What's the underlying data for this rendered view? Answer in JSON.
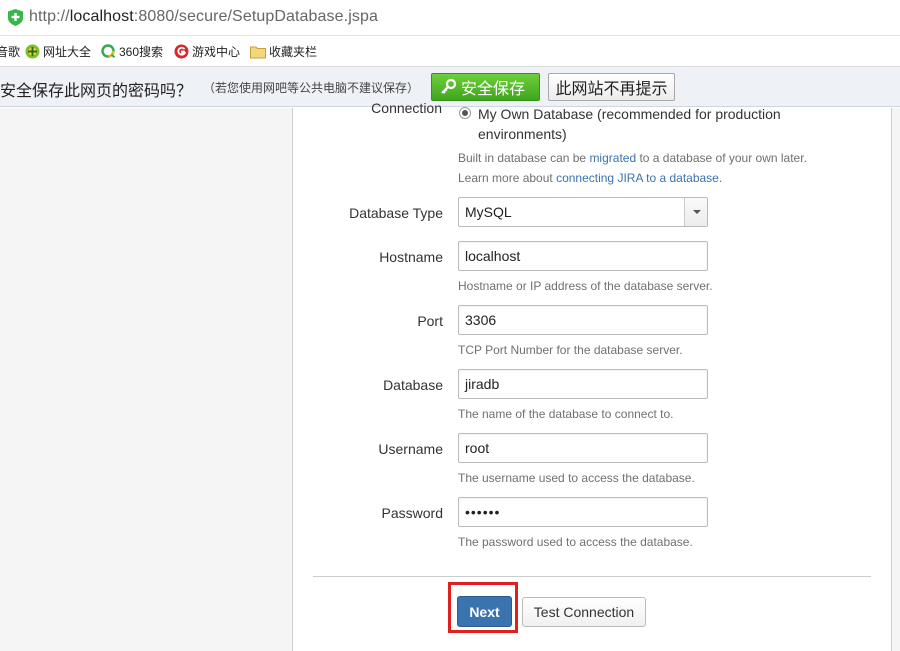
{
  "browser": {
    "url_prefix": "http://",
    "url_host": "localhost",
    "url_rest": ":8080/secure/SetupDatabase.jspa"
  },
  "bookmarks": {
    "items": [
      {
        "label": "音歌",
        "icon": "bookmark-icon"
      },
      {
        "label": "网址大全",
        "icon": "directory-icon"
      },
      {
        "label": "360搜索",
        "icon": "search-360-icon"
      },
      {
        "label": "游戏中心",
        "icon": "game-center-icon"
      },
      {
        "label": "收藏夹栏",
        "icon": "folder-icon"
      }
    ]
  },
  "infobar": {
    "question": "安全保存此网页的密码吗？",
    "hint": "（若您使用网吧等公共电脑不建议保存）",
    "save_label": "安全保存",
    "no_more_label": "此网站不再提示"
  },
  "form": {
    "connection_label": "Connection",
    "own_db_option": "My Own Database (recommended for production environments)",
    "builtin_help_pre": "Built in database can be ",
    "builtin_help_link": "migrated",
    "builtin_help_post": " to a database of your own later.",
    "learn_pre": "Learn more about ",
    "learn_link": "connecting JIRA to a database",
    "learn_post": ".",
    "db_type_label": "Database Type",
    "db_type_value": "MySQL",
    "hostname_label": "Hostname",
    "hostname_value": "localhost",
    "hostname_help": "Hostname or IP address of the database server.",
    "port_label": "Port",
    "port_value": "3306",
    "port_help": "TCP Port Number for the database server.",
    "database_label": "Database",
    "database_value": "jiradb",
    "database_help": "The name of the database to connect to.",
    "username_label": "Username",
    "username_value": "root",
    "username_help": "The username used to access the database.",
    "password_label": "Password",
    "password_value": "••••••",
    "password_help": "The password used to access the database."
  },
  "actions": {
    "next_label": "Next",
    "test_label": "Test Connection"
  },
  "colors": {
    "primary_button": "#3b73af",
    "highlight_box": "#e0201f",
    "save_green": "#4fb526"
  }
}
